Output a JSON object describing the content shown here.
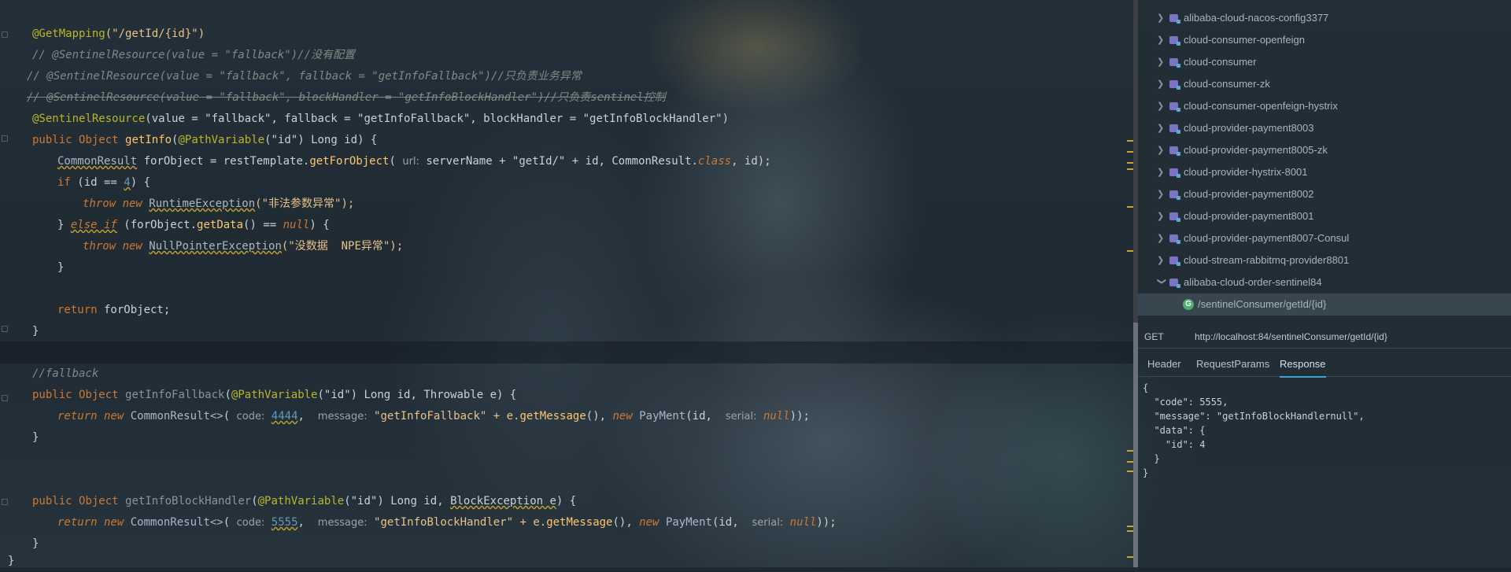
{
  "editor": {
    "line1": {
      "ann": "@GetMapping",
      "arg": "(\"/getId/{id}\")"
    },
    "line2": "// @SentinelResource(value = \"fallback\")//没有配置",
    "line3": "// @SentinelResource(value = \"fallback\", fallback = \"getInfoFallback\")//只负责业务异常",
    "line4": "// @SentinelResource(value = \"fallback\", blockHandler = \"getInfoBlockHandler\")//只负责sentinel控制",
    "line5": {
      "ann": "@SentinelResource",
      "args": "(value = \"fallback\", fallback = \"getInfoFallback\", blockHandler = \"getInfoBlockHandler\")"
    },
    "line6": {
      "kw": "public",
      "type": "Object",
      "fn": "getInfo",
      "ann": "@PathVariable",
      "rest": "(\"id\") Long id) {"
    },
    "line7": {
      "cls": "CommonResult",
      "a": " forObject = restTemplate.",
      "fn": "getForObject",
      "b": "(",
      "hint": "url:",
      "c": " serverName + \"getId/\" + id, CommonResult.",
      "kw": "class",
      "d": ", id);"
    },
    "line8": {
      "kw": "if",
      "a": " (id == ",
      "num": "4",
      "b": ") {"
    },
    "line9": {
      "kw": "throw new",
      "cls": "RuntimeException",
      "rest": "(\"非法参数异常\");"
    },
    "line10": {
      "a": "} ",
      "kw": "else if",
      "b": " (forObject.",
      "fn": "getData",
      "c": "() == ",
      "kw2": "null",
      "d": ") {"
    },
    "line11": {
      "kw": "throw new",
      "cls": "NullPointerException",
      "rest": "(\"没数据  NPE异常\");"
    },
    "line12": "}",
    "line14": {
      "kw": "return",
      "rest": " forObject;"
    },
    "line15": "}",
    "line17": "//fallback",
    "line18": {
      "kw": "public",
      "type": "Object",
      "fn": "getInfoFallback",
      "ann": "@PathVariable",
      "rest": "(\"id\") Long id, Throwable e) {"
    },
    "line19": {
      "kw": "return new",
      "cls": "CommonResult<>",
      "a": "( ",
      "hint1": "code:",
      "num": "4444",
      "b": ",  ",
      "hint2": "message:",
      "c": " \"getInfoFallback\" + e.",
      "fn": "getMessage",
      "d": "(), ",
      "kw2": "new",
      "cls2": "PayMent",
      "e": "(id,  ",
      "hint3": "serial:",
      "kw3": "null",
      "f": "));"
    },
    "line20": "}",
    "line23": {
      "kw": "public",
      "type": "Object",
      "fn": "getInfoBlockHandler",
      "ann": "@PathVariable",
      "rest": "(\"id\") Long id, ",
      "cls": "BlockException e",
      "end": ") {"
    },
    "line24": {
      "kw": "return new",
      "cls": "CommonResult<>",
      "a": "( ",
      "hint1": "code:",
      "num": "5555",
      "b": ",  ",
      "hint2": "message:",
      "c": " \"getInfoBlockHandler\" + e.",
      "fn": "getMessage",
      "d": "(), ",
      "kw2": "new",
      "cls2": "PayMent",
      "e": "(id,  ",
      "hint3": "serial:",
      "kw3": "null",
      "f": "));"
    },
    "line25": "}",
    "line26": "}"
  },
  "tree": {
    "items": [
      "alibaba-cloud-nacos-config3377",
      "cloud-consumer-openfeign",
      "cloud-consumer",
      "cloud-consumer-zk",
      "cloud-consumer-openfeign-hystrix",
      "cloud-provider-payment8003",
      "cloud-provider-payment8005-zk",
      "cloud-provider-hystrix-8001",
      "cloud-provider-payment8002",
      "cloud-provider-payment8001",
      "cloud-provider-payment8007-Consul",
      "cloud-stream-rabbitmq-provider8801",
      "alibaba-cloud-order-sentinel84"
    ],
    "endpoint_badge": "G",
    "endpoint": "/sentinelConsumer/getId/{id}"
  },
  "request": {
    "method": "GET",
    "url": "http://localhost:84/sentinelConsumer/getId/{id}"
  },
  "tabs": [
    "Header",
    "RequestParams",
    "Response"
  ],
  "response": {
    "lines": [
      "{",
      "  \"code\": 5555,",
      "  \"message\": \"getInfoBlockHandlernull\",",
      "  \"data\": {",
      "    \"id\": 4",
      "  }",
      "}"
    ]
  },
  "colors": {
    "accent": "#3fa4c9",
    "keyword": "#cc7832",
    "string": "#e8c28a",
    "annotation": "#bbb529"
  }
}
